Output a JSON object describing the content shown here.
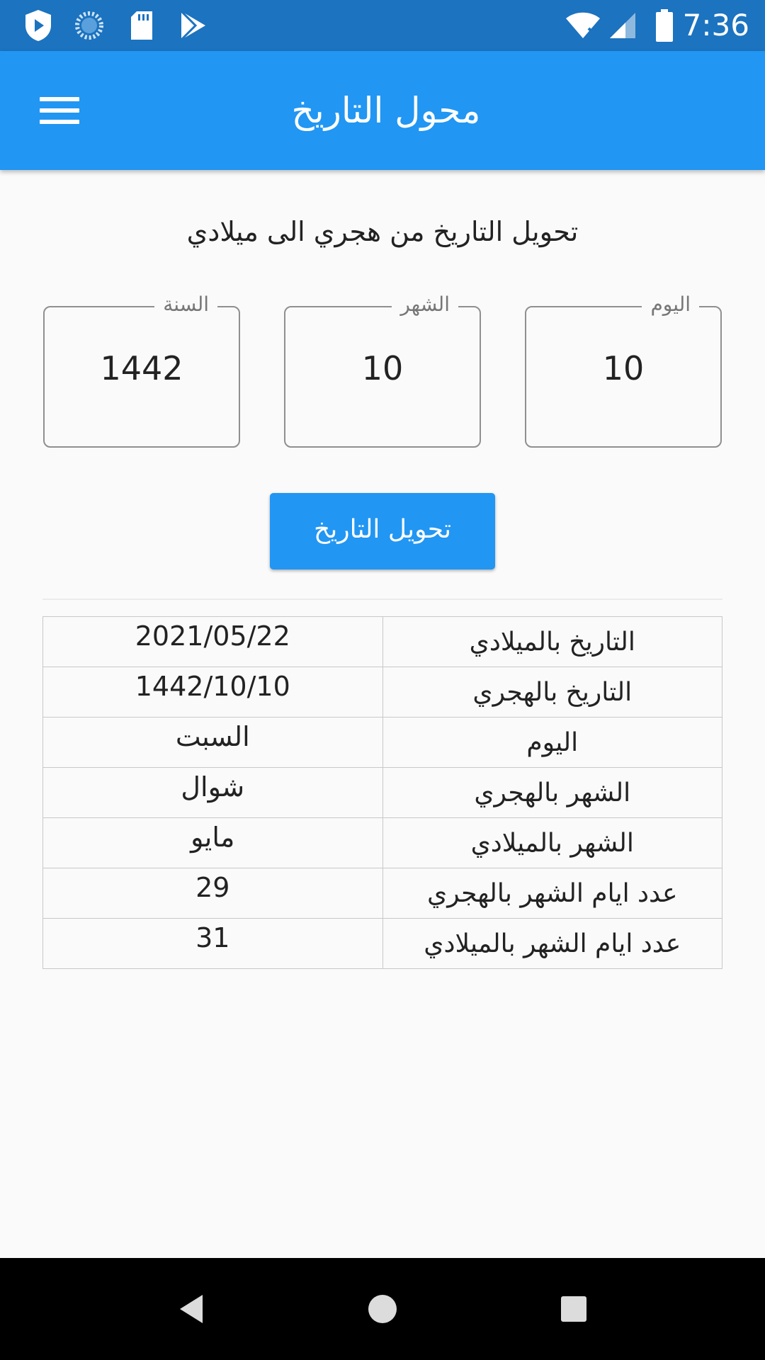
{
  "status_bar": {
    "time": "7:36",
    "icons": [
      "shield-play-icon",
      "loading-icon",
      "sd-card-icon",
      "play-store-icon",
      "wifi-off-icon",
      "signal-icon",
      "battery-icon"
    ]
  },
  "app_bar": {
    "title": "محول التاريخ",
    "menu_icon": "hamburger-menu-icon"
  },
  "main": {
    "subtitle": "تحويل التاريخ من هجري الى ميلادي",
    "fields": {
      "day": {
        "label": "اليوم",
        "value": "10"
      },
      "month": {
        "label": "الشهر",
        "value": "10"
      },
      "year": {
        "label": "السنة",
        "value": "1442"
      }
    },
    "convert_button": "تحويل التاريخ",
    "results": [
      {
        "label": "التاريخ بالميلادي",
        "value": "2021/05/22"
      },
      {
        "label": "التاريخ بالهجري",
        "value": "1442/10/10"
      },
      {
        "label": "اليوم",
        "value": "السبت"
      },
      {
        "label": "الشهر بالهجري",
        "value": "شوال"
      },
      {
        "label": "الشهر بالميلادي",
        "value": "مايو"
      },
      {
        "label": "عدد ايام الشهر بالهجري",
        "value": "29"
      },
      {
        "label": "عدد ايام الشهر بالميلادي",
        "value": "31"
      }
    ]
  },
  "nav_bar": {
    "icons": [
      "back-icon",
      "home-icon",
      "recents-icon"
    ]
  },
  "colors": {
    "status_bar": "#1c73bf",
    "app_bar": "#2196f3",
    "button": "#2196f3",
    "background": "#fafafa"
  }
}
